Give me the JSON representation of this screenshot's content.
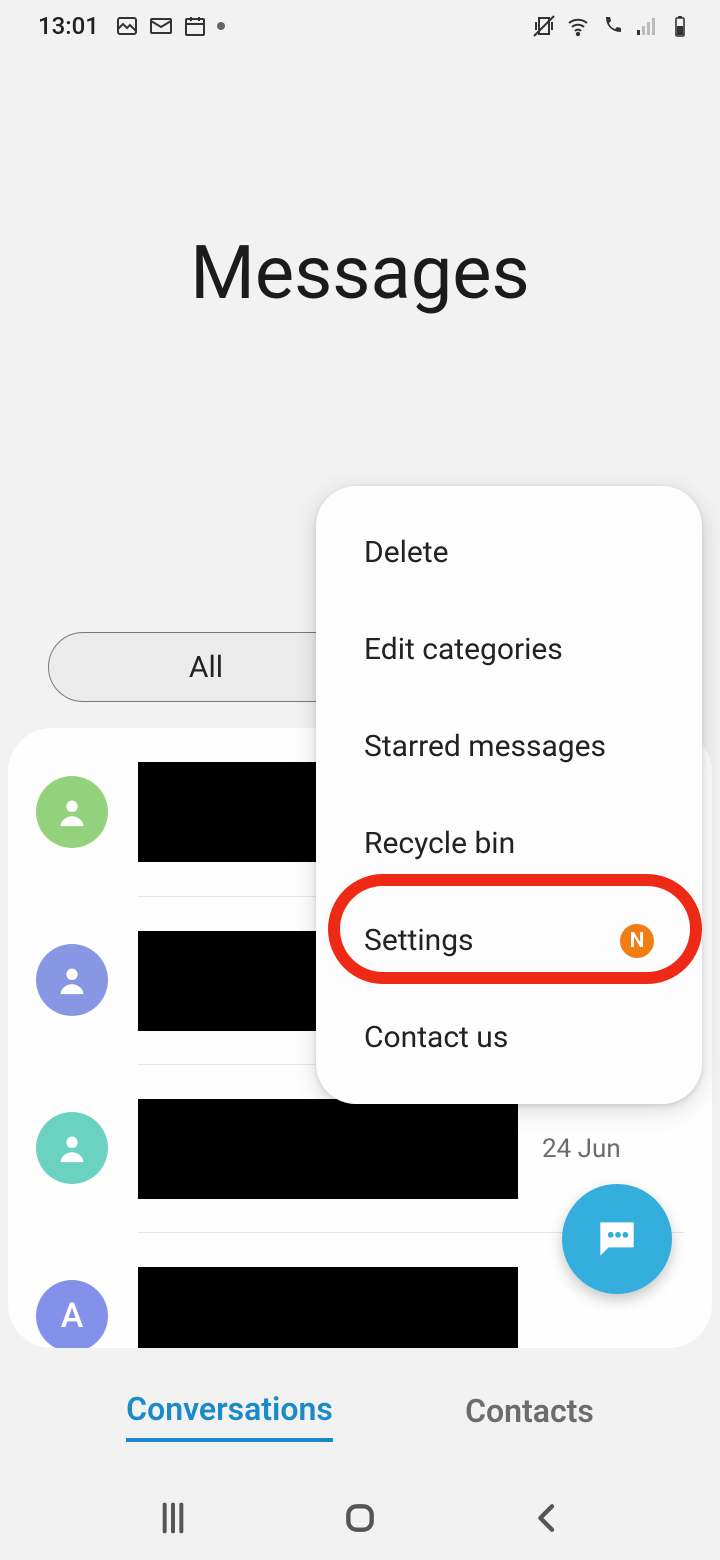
{
  "status": {
    "time": "13:01"
  },
  "header": {
    "title": "Messages"
  },
  "chips": {
    "all": "All"
  },
  "popup": {
    "items": [
      {
        "label": "Delete"
      },
      {
        "label": "Edit categories"
      },
      {
        "label": "Starred messages"
      },
      {
        "label": "Recycle bin"
      },
      {
        "label": "Settings",
        "badge": "N"
      },
      {
        "label": "Contact us"
      }
    ]
  },
  "conversations": [
    {
      "avatar_bg": "#94d17d",
      "avatar_letter": "",
      "date": ""
    },
    {
      "avatar_bg": "#8897e4",
      "avatar_letter": "",
      "date": ""
    },
    {
      "avatar_bg": "#6bd1c0",
      "avatar_letter": "",
      "date": "24 Jun"
    },
    {
      "avatar_bg": "#8391ea",
      "avatar_letter": "A",
      "date": ""
    }
  ],
  "bottom_tabs": {
    "conversations": "Conversations",
    "contacts": "Contacts"
  }
}
